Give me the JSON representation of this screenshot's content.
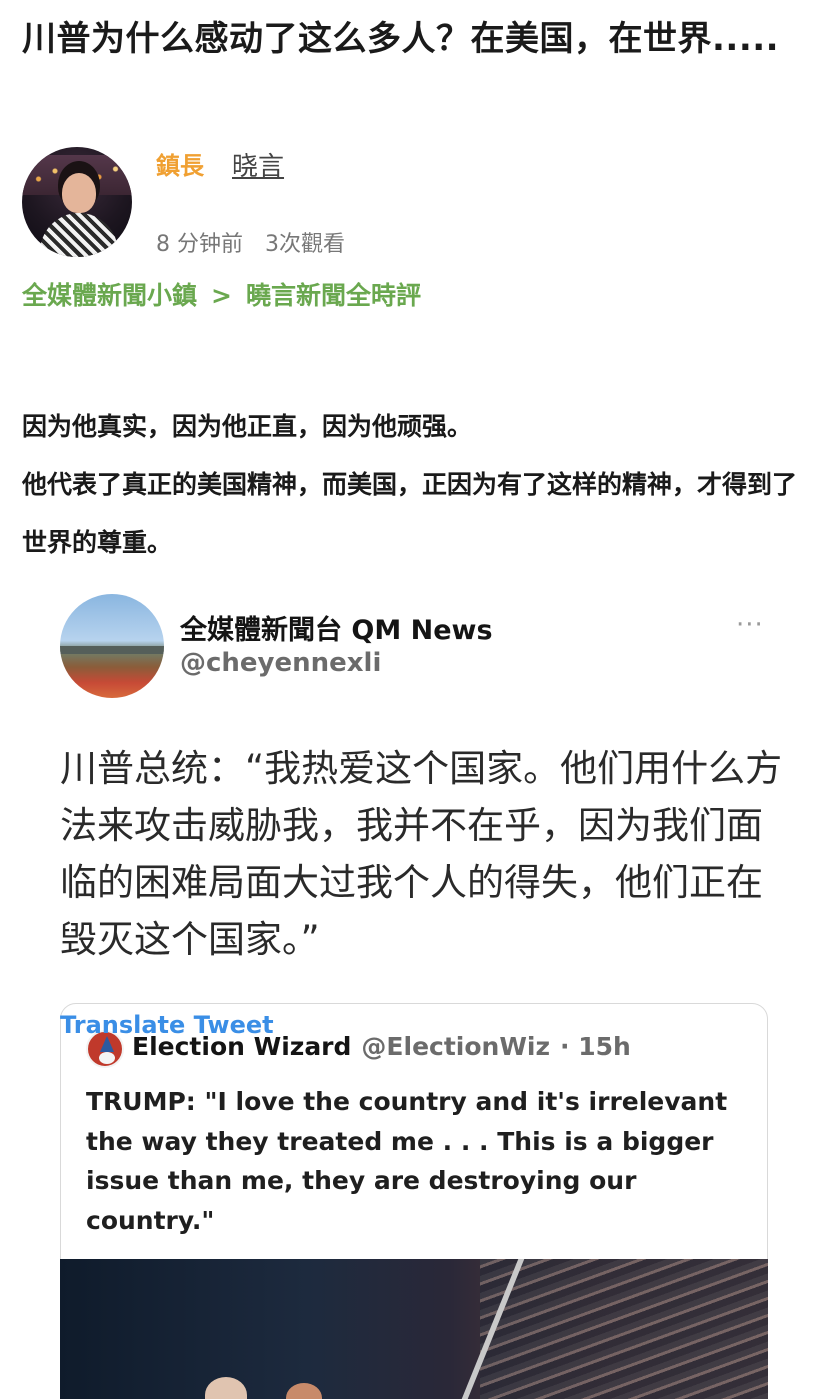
{
  "article": {
    "title": "川普为什么感动了这么多人？在美国，在世界.....",
    "author_name": "鎮長",
    "author_link": "晓言",
    "time_ago": "8 分钟前",
    "views": "3次觀看",
    "breadcrumb": {
      "parent": "全媒體新聞小鎮",
      "separator": ">",
      "child": "曉言新聞全時評"
    },
    "paragraphs": [
      "因为他真实，因为他正直，因为他顽强。",
      "他代表了真正的美国精神，而美国，正因为有了这样的精神，才得到了世界的尊重。"
    ]
  },
  "tweet": {
    "name": "全媒體新聞台 QM News",
    "handle": "@cheyennexli",
    "more_label": "···",
    "text": "川普总统：“我热爱这个国家。他们用什么方法来攻击威胁我，我并不在乎，因为我们面临的困难局面大过我个人的得失，他们正在毁灭这个国家。”",
    "translate_label": "Translate Tweet",
    "quoted": {
      "name": "Election Wizard",
      "handle": "@ElectionWiz",
      "time": "· 15h",
      "text": "TRUMP: \"I love the country and it's irrelevant the way they treated me . . . This is a bigger issue than me, they are destroying our country.\""
    }
  },
  "colors": {
    "author_name": "#f0a032",
    "breadcrumb": "#6aa84f",
    "translate_link": "#3a8ee6"
  }
}
